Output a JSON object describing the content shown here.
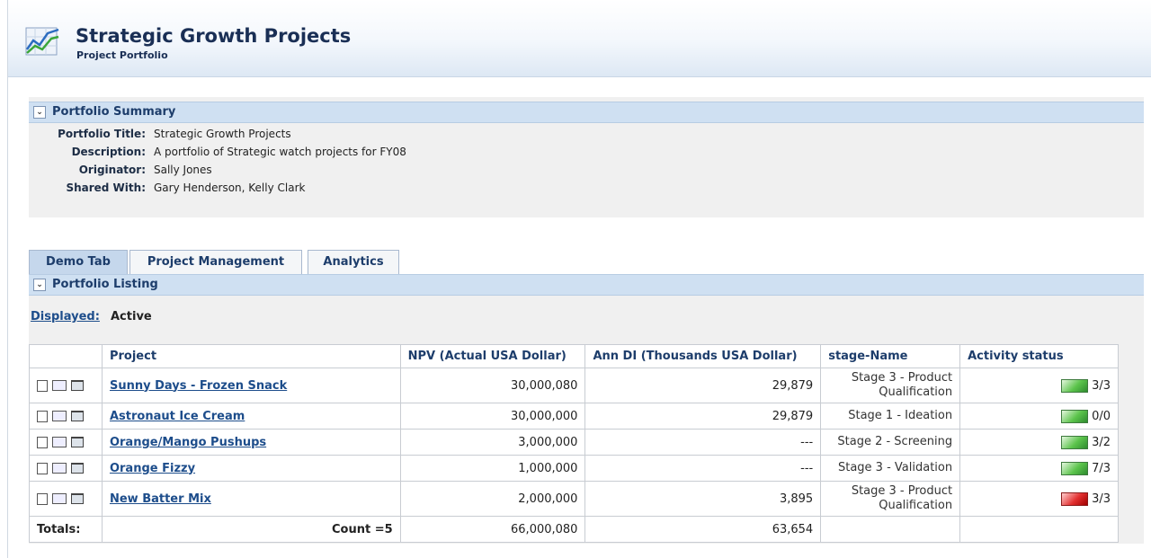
{
  "header": {
    "title": "Strategic Growth Projects",
    "subtitle": "Project Portfolio",
    "icon": "chart-trend-icon"
  },
  "summary": {
    "section_title": "Portfolio Summary",
    "rows": [
      {
        "label": "Portfolio Title:",
        "value": "Strategic Growth Projects"
      },
      {
        "label": "Description:",
        "value": "A portfolio of Strategic watch projects for FY08"
      },
      {
        "label": "Originator:",
        "value": "Sally Jones"
      },
      {
        "label": "Shared With:",
        "value": "Gary Henderson, Kelly Clark"
      }
    ]
  },
  "tabs": [
    {
      "label": "Demo Tab",
      "active": true
    },
    {
      "label": "Project Management",
      "active": false
    },
    {
      "label": "Analytics",
      "active": false
    }
  ],
  "listing": {
    "section_title": "Portfolio Listing",
    "displayed_label": "Displayed:",
    "displayed_value": "Active",
    "columns": [
      "",
      "Project",
      "NPV (Actual USA Dollar)",
      "Ann DI (Thousands USA Dollar)",
      "stage-Name",
      "Activity status"
    ],
    "rows": [
      {
        "project": "Sunny Days - Frozen Snack",
        "npv": "30,000,080",
        "ann_di": "29,879",
        "stage_line1": "Stage 3 - Product",
        "stage_line2": "Qualification",
        "status_color": "green",
        "status_text": "3/3"
      },
      {
        "project": "Astronaut Ice Cream",
        "npv": "30,000,000",
        "ann_di": "29,879",
        "stage_line1": "Stage 1 - Ideation",
        "stage_line2": "",
        "status_color": "green",
        "status_text": "0/0"
      },
      {
        "project": "Orange/Mango Pushups",
        "npv": "3,000,000",
        "ann_di": "---",
        "stage_line1": "Stage 2 - Screening",
        "stage_line2": "",
        "status_color": "green",
        "status_text": "3/2"
      },
      {
        "project": "Orange Fizzy",
        "npv": "1,000,000",
        "ann_di": "---",
        "stage_line1": "Stage 3 - Validation",
        "stage_line2": "",
        "status_color": "green",
        "status_text": "7/3"
      },
      {
        "project": "New Batter Mix",
        "npv": "2,000,000",
        "ann_di": "3,895",
        "stage_line1": "Stage 3 - Product",
        "stage_line2": "Qualification",
        "status_color": "red",
        "status_text": "3/3"
      }
    ],
    "totals": {
      "label": "Totals:",
      "count": "Count =5",
      "npv": "66,000,080",
      "ann_di": "63,654"
    }
  },
  "colors": {
    "section_bar": "#cfe0f2",
    "link": "#1d4d8b",
    "status_green": "#5cc44c",
    "status_red": "#e23030"
  }
}
